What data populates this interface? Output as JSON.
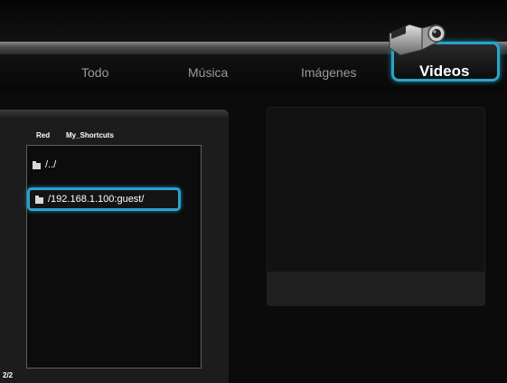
{
  "tabs": [
    {
      "label": "Todo"
    },
    {
      "label": "Música"
    },
    {
      "label": "Imágenes"
    },
    {
      "label": "Videos",
      "active": true
    }
  ],
  "breadcrumb": {
    "root": "Red",
    "current": "My_Shortcuts"
  },
  "items": [
    {
      "label": "/../",
      "icon": "folder-icon"
    },
    {
      "label": "/192.168.1.100:guest/",
      "icon": "folder-icon",
      "selected": true
    }
  ],
  "pager": "2/2",
  "colors": {
    "accent": "#2aa3c8",
    "background": "#0b0b0b",
    "text": "#ffffff",
    "inactive_tab": "#9a9a9a"
  }
}
